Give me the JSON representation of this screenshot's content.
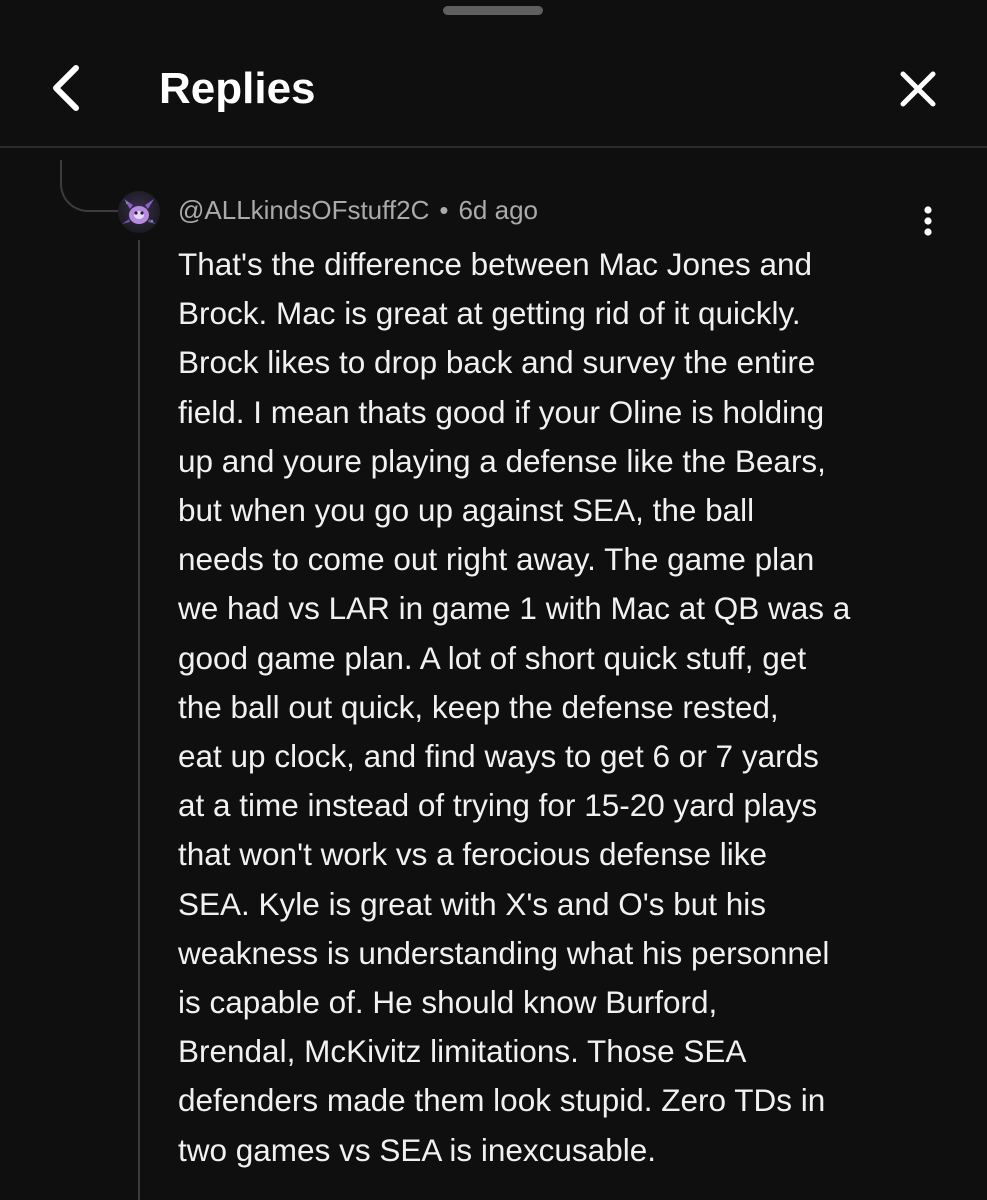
{
  "header": {
    "title": "Replies"
  },
  "icons": {
    "back": "chevron-left-icon",
    "close": "close-icon",
    "more": "vertical-dots-icon"
  },
  "comment": {
    "author": "@ALLkindsOFstuff2C",
    "separator": "•",
    "time": "6d ago",
    "lines": [
      "That's the difference between Mac Jones and",
      "Brock. Mac is great at getting rid of it quickly.",
      "Brock likes to drop back and survey the entire",
      "field. I mean thats good if your Oline is holding",
      "up and youre playing a defense like the Bears,",
      "but when you go up against SEA, the ball",
      "needs to come out right away. The game plan",
      "we had vs LAR in game 1 with Mac at QB was a",
      "good game plan. A lot of short quick stuff, get",
      "the ball out quick, keep the defense rested,",
      "eat up clock, and find ways to get 6 or 7 yards",
      "at a time instead of trying for 15-20 yard plays",
      "that won't work vs a ferocious defense like",
      "SEA. Kyle is great with X's and O's but his",
      "weakness is understanding what his personnel",
      "is capable of. He should know Burford,",
      "Brendal, McKivitz limitations. Those SEA",
      "defenders made them look stupid. Zero TDs in",
      "two games vs SEA is inexcusable."
    ]
  },
  "colors": {
    "background": "#0f0f0f",
    "text": "#f1f1f1",
    "meta": "#aaaaaa",
    "thread_line": "#3c3c3c"
  }
}
